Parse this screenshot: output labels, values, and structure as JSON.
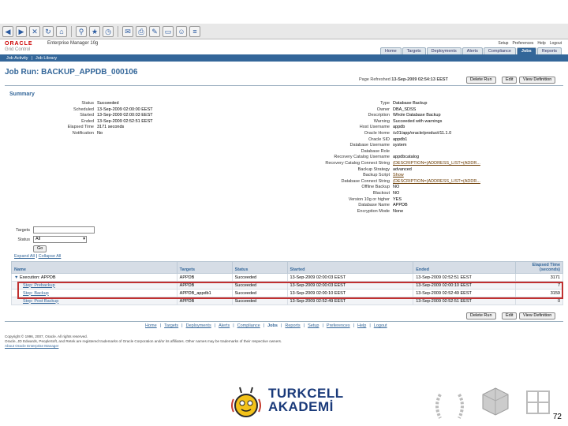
{
  "header": {
    "logo": "ORACLE",
    "product": "Enterprise Manager 10g",
    "subtitle": "Grid Control",
    "global_links": [
      "Setup",
      "Preferences",
      "Help",
      "Logout"
    ],
    "tabs": [
      "Home",
      "Targets",
      "Deployments",
      "Alerts",
      "Compliance",
      "Jobs",
      "Reports"
    ],
    "active_tab": "Jobs"
  },
  "subnav": [
    "Job Activity",
    "Job Library"
  ],
  "page": {
    "title": "Job Run: BACKUP_APPDB_000106",
    "refreshed_label": "Page Refreshed",
    "refreshed_value": "13-Sep-2009 02:54:13 EEST",
    "buttons": [
      "Delete Run",
      "Edit",
      "View Definition"
    ]
  },
  "summary": {
    "heading": "Summary",
    "left": [
      {
        "k": "Status",
        "v": "Succeeded"
      },
      {
        "k": "Scheduled",
        "v": "13-Sep-2009 02:00:00 EEST"
      },
      {
        "k": "Started",
        "v": "13-Sep-2009 02:00:03 EEST"
      },
      {
        "k": "Ended",
        "v": "13-Sep-2009 02:52:51 EEST"
      },
      {
        "k": "Elapsed Time",
        "v": "3171 seconds"
      },
      {
        "k": "Notification",
        "v": "No"
      }
    ],
    "right": [
      {
        "k": "Type",
        "v": "Database Backup"
      },
      {
        "k": "Owner",
        "v": "DBA_SDSS"
      },
      {
        "k": "Description",
        "v": "Whole Database Backup"
      },
      {
        "k": "Warning",
        "v": "Succeeded with warnings"
      },
      {
        "k": "Host Username",
        "v": "appdb"
      },
      {
        "k": "Oracle Home",
        "v": "/u01/app/oracle/product/11.1.0"
      },
      {
        "k": "Oracle SID",
        "v": "appdb1"
      },
      {
        "k": "Database Username",
        "v": "system"
      },
      {
        "k": "Database Role",
        "v": ""
      },
      {
        "k": "Recovery Catalog Username",
        "v": "appdbcatalog"
      },
      {
        "k": "Recovery Catalog Connect String",
        "v": "(DESCRIPTION=(ADDRESS_LIST=(ADDR..."
      },
      {
        "k": "Backup Strategy",
        "v": "advanced"
      },
      {
        "k": "Backup Script",
        "v": "Show"
      },
      {
        "k": "Database Connect String",
        "v": "(DESCRIPTION=(ADDRESS_LIST=(ADDR..."
      },
      {
        "k": "Offline Backup",
        "v": "NO"
      },
      {
        "k": "Blackout",
        "v": "NO"
      },
      {
        "k": "Version 10g or higher",
        "v": "YES"
      },
      {
        "k": "Database Name",
        "v": "APPDB"
      },
      {
        "k": "Encryption Mode",
        "v": "None"
      }
    ]
  },
  "filter": {
    "targets_label": "Targets",
    "targets_value": "",
    "status_label": "Status",
    "status_value": "All",
    "go_label": "Go"
  },
  "expand_links": {
    "expand": "Expand All",
    "collapse": "Collapse All"
  },
  "table": {
    "headers": [
      "Name",
      "Targets",
      "Status",
      "Started",
      "Ended",
      "Elapsed Time (seconds)"
    ],
    "rows": [
      {
        "name": "Execution: APPDB",
        "target": "APPDB",
        "status": "Succeeded",
        "started": "13-Sep-2009 02:00:03 EEST",
        "ended": "13-Sep-2009 02:52:51 EEST",
        "elapsed": "3171"
      },
      {
        "name": "Step: Prebackup",
        "target": "APPDB",
        "status": "Succeeded",
        "started": "13-Sep-2009 02:00:03 EEST",
        "ended": "13-Sep-2009 02:00:10 EEST",
        "elapsed": "7"
      },
      {
        "name": "Step: Backup",
        "target": "APPDB_appdb1",
        "status": "Succeeded",
        "started": "13-Sep-2009 02:00:10 EEST",
        "ended": "13-Sep-2009 02:52:49 EEST",
        "elapsed": "3159"
      },
      {
        "name": "Step: Post Backup",
        "target": "APPDB",
        "status": "Succeeded",
        "started": "13-Sep-2009 02:52:49 EEST",
        "ended": "13-Sep-2009 02:52:51 EEST",
        "elapsed": "0"
      }
    ]
  },
  "footer": {
    "links": [
      "Home",
      "Targets",
      "Deployments",
      "Alerts",
      "Compliance",
      "Jobs",
      "Reports",
      "Setup",
      "Preferences",
      "Help",
      "Logout"
    ],
    "copyright1": "Copyright © 1996, 2007, Oracle. All rights reserved.",
    "copyright2": "Oracle, JD Edwards, PeopleSoft, and Retek are registered trademarks of Oracle Corporation and/or its affiliates. Other names may be trademarks of their respective owners.",
    "about": "About Oracle Enterprise Manager"
  },
  "brand": {
    "line1": "TURKCELL",
    "line2": "AKADEMİ",
    "page_number": "72"
  }
}
